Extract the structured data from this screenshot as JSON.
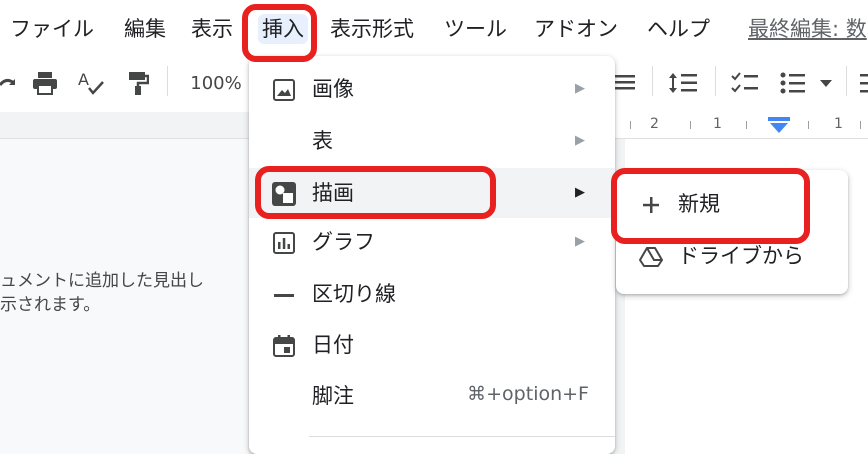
{
  "menubar": {
    "items": [
      "ファイル",
      "編集",
      "表示",
      "挿入",
      "表示形式",
      "ツール",
      "アドオン",
      "ヘルプ"
    ],
    "last_edit": "最終編集: 数"
  },
  "toolbar": {
    "zoom": "100%",
    "icons": [
      "redo-icon",
      "print-icon",
      "spellcheck-icon",
      "paint-format-icon",
      "align-icon",
      "line-spacing-icon",
      "checklist-icon",
      "bulleted-list-icon",
      "dropdown-icon"
    ]
  },
  "ruler": {
    "numbers": [
      "2",
      "1",
      "1"
    ]
  },
  "outline": {
    "line1": "ュメントに追加した見出し",
    "line2": "示されます。"
  },
  "insert_menu": {
    "items": [
      {
        "label": "画像",
        "icon": "image-icon",
        "has_submenu": true
      },
      {
        "label": "表",
        "icon": "",
        "has_submenu": true
      },
      {
        "label": "描画",
        "icon": "drawing-icon",
        "has_submenu": true
      },
      {
        "label": "グラフ",
        "icon": "chart-icon",
        "has_submenu": true
      },
      {
        "label": "区切り線",
        "icon": "horizontal-line-icon",
        "has_submenu": false
      },
      {
        "label": "日付",
        "icon": "calendar-icon",
        "has_submenu": false
      },
      {
        "label": "脚注",
        "icon": "",
        "has_submenu": false,
        "shortcut": "⌘+option+F"
      }
    ],
    "arrow": "▶"
  },
  "drawing_submenu": {
    "items": [
      {
        "label": "新規",
        "icon": "plus-icon"
      },
      {
        "label": "ドライブから",
        "icon": "drive-icon"
      }
    ]
  },
  "colors": {
    "highlight": "#e8201f",
    "menu_bg": "#ffffff",
    "hover_bg": "#f1f3f4",
    "accent_blue": "#4285f4"
  }
}
